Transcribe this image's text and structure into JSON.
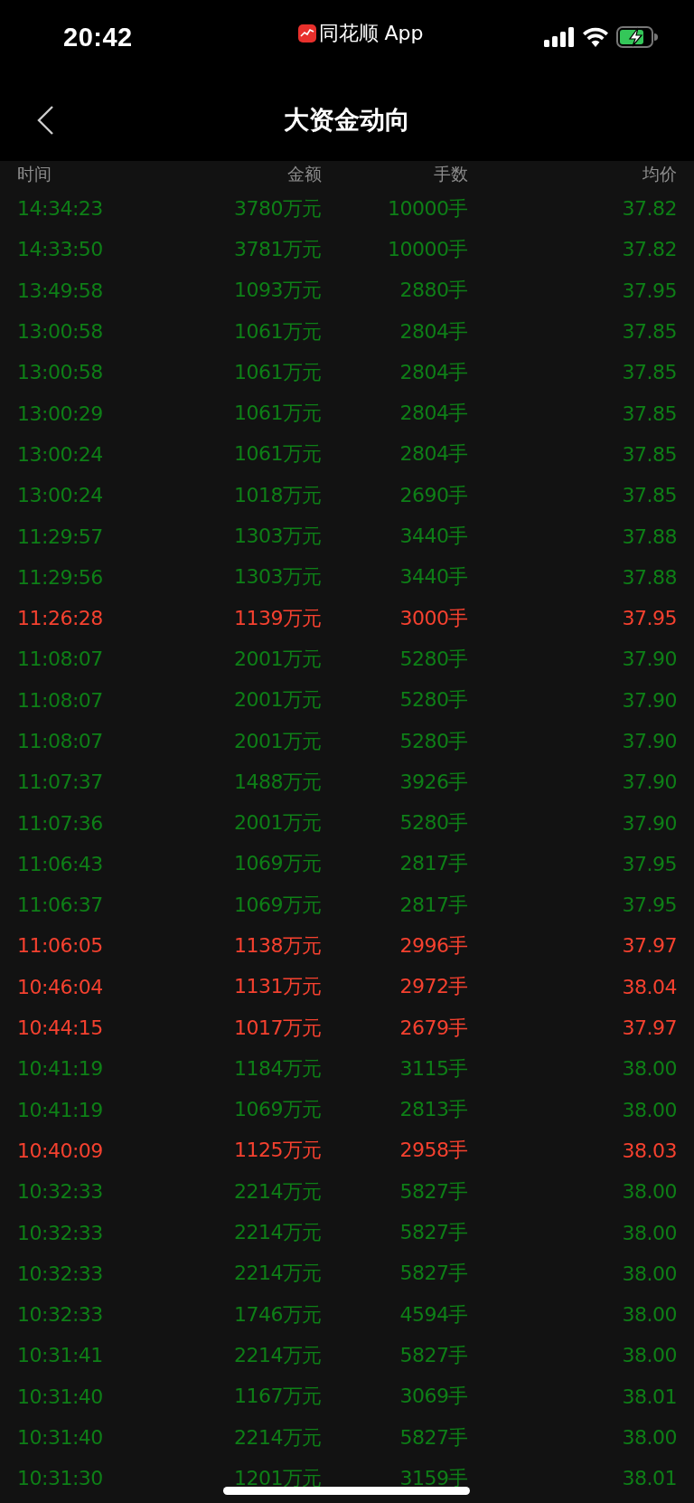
{
  "status_bar": {
    "time": "20:42",
    "app_label": "同花顺 App"
  },
  "nav": {
    "title": "大资金动向"
  },
  "table": {
    "columns": [
      "时间",
      "金额",
      "手数",
      "均价"
    ],
    "rows": [
      {
        "time": "14:34:23",
        "amount": "3780万元",
        "hands": "10000手",
        "price": "37.82",
        "color": "#0e7f17"
      },
      {
        "time": "14:33:50",
        "amount": "3781万元",
        "hands": "10000手",
        "price": "37.82",
        "color": "#0e7f17"
      },
      {
        "time": "13:49:58",
        "amount": "1093万元",
        "hands": "2880手",
        "price": "37.95",
        "color": "#0e7f17"
      },
      {
        "time": "13:00:58",
        "amount": "1061万元",
        "hands": "2804手",
        "price": "37.85",
        "color": "#0e7f17"
      },
      {
        "time": "13:00:58",
        "amount": "1061万元",
        "hands": "2804手",
        "price": "37.85",
        "color": "#0e7f17"
      },
      {
        "time": "13:00:29",
        "amount": "1061万元",
        "hands": "2804手",
        "price": "37.85",
        "color": "#0e7f17"
      },
      {
        "time": "13:00:24",
        "amount": "1061万元",
        "hands": "2804手",
        "price": "37.85",
        "color": "#0e7f17"
      },
      {
        "time": "13:00:24",
        "amount": "1018万元",
        "hands": "2690手",
        "price": "37.85",
        "color": "#0e7f17"
      },
      {
        "time": "11:29:57",
        "amount": "1303万元",
        "hands": "3440手",
        "price": "37.88",
        "color": "#0e7f17"
      },
      {
        "time": "11:29:56",
        "amount": "1303万元",
        "hands": "3440手",
        "price": "37.88",
        "color": "#0e7f17"
      },
      {
        "time": "11:26:28",
        "amount": "1139万元",
        "hands": "3000手",
        "price": "37.95",
        "color": "#f5412f"
      },
      {
        "time": "11:08:07",
        "amount": "2001万元",
        "hands": "5280手",
        "price": "37.90",
        "color": "#0e7f17"
      },
      {
        "time": "11:08:07",
        "amount": "2001万元",
        "hands": "5280手",
        "price": "37.90",
        "color": "#0e7f17"
      },
      {
        "time": "11:08:07",
        "amount": "2001万元",
        "hands": "5280手",
        "price": "37.90",
        "color": "#0e7f17"
      },
      {
        "time": "11:07:37",
        "amount": "1488万元",
        "hands": "3926手",
        "price": "37.90",
        "color": "#0e7f17"
      },
      {
        "time": "11:07:36",
        "amount": "2001万元",
        "hands": "5280手",
        "price": "37.90",
        "color": "#0e7f17"
      },
      {
        "time": "11:06:43",
        "amount": "1069万元",
        "hands": "2817手",
        "price": "37.95",
        "color": "#0e7f17"
      },
      {
        "time": "11:06:37",
        "amount": "1069万元",
        "hands": "2817手",
        "price": "37.95",
        "color": "#0e7f17"
      },
      {
        "time": "11:06:05",
        "amount": "1138万元",
        "hands": "2996手",
        "price": "37.97",
        "color": "#f5412f"
      },
      {
        "time": "10:46:04",
        "amount": "1131万元",
        "hands": "2972手",
        "price": "38.04",
        "color": "#f5412f"
      },
      {
        "time": "10:44:15",
        "amount": "1017万元",
        "hands": "2679手",
        "price": "37.97",
        "color": "#f5412f"
      },
      {
        "time": "10:41:19",
        "amount": "1184万元",
        "hands": "3115手",
        "price": "38.00",
        "color": "#0e7f17"
      },
      {
        "time": "10:41:19",
        "amount": "1069万元",
        "hands": "2813手",
        "price": "38.00",
        "color": "#0e7f17"
      },
      {
        "time": "10:40:09",
        "amount": "1125万元",
        "hands": "2958手",
        "price": "38.03",
        "color": "#f5412f"
      },
      {
        "time": "10:32:33",
        "amount": "2214万元",
        "hands": "5827手",
        "price": "38.00",
        "color": "#0e7f17"
      },
      {
        "time": "10:32:33",
        "amount": "2214万元",
        "hands": "5827手",
        "price": "38.00",
        "color": "#0e7f17"
      },
      {
        "time": "10:32:33",
        "amount": "2214万元",
        "hands": "5827手",
        "price": "38.00",
        "color": "#0e7f17"
      },
      {
        "time": "10:32:33",
        "amount": "1746万元",
        "hands": "4594手",
        "price": "38.00",
        "color": "#0e7f17"
      },
      {
        "time": "10:31:41",
        "amount": "2214万元",
        "hands": "5827手",
        "price": "38.00",
        "color": "#0e7f17"
      },
      {
        "time": "10:31:40",
        "amount": "1167万元",
        "hands": "3069手",
        "price": "38.01",
        "color": "#0e7f17"
      },
      {
        "time": "10:31:40",
        "amount": "2214万元",
        "hands": "5827手",
        "price": "38.00",
        "color": "#0e7f17"
      },
      {
        "time": "10:31:30",
        "amount": "1201万元",
        "hands": "3159手",
        "price": "38.01",
        "color": "#0e7f17"
      }
    ]
  }
}
